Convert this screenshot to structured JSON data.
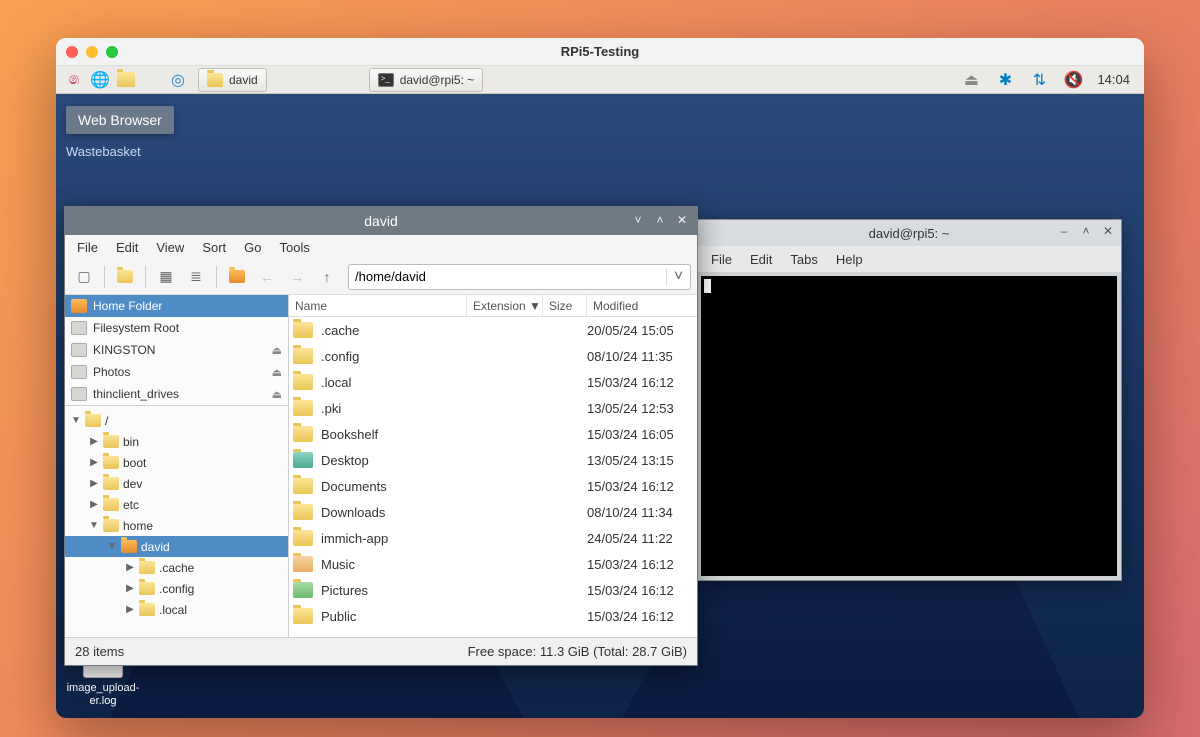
{
  "outer_title": "RPi5-Testing",
  "taskbar": {
    "tasks": [
      {
        "label": "david"
      },
      {
        "label": "david@rpi5: ~"
      }
    ],
    "clock": "14:04"
  },
  "tooltip": "Web Browser",
  "desktop": {
    "wastebasket": "Wastebasket",
    "icon_label": "image_upload-\ner.log"
  },
  "terminal": {
    "title": "david@rpi5: ~",
    "menu": [
      "File",
      "Edit",
      "Tabs",
      "Help"
    ]
  },
  "fm": {
    "title": "david",
    "menu": [
      "File",
      "Edit",
      "View",
      "Sort",
      "Go",
      "Tools"
    ],
    "path": "/home/david",
    "places": [
      {
        "label": "Home Folder",
        "icon": "home",
        "selected": true
      },
      {
        "label": "Filesystem Root",
        "icon": "drive"
      },
      {
        "label": "KINGSTON",
        "icon": "drive",
        "eject": true
      },
      {
        "label": "Photos",
        "icon": "drive",
        "eject": true
      },
      {
        "label": "thinclient_drives",
        "icon": "drive",
        "eject": true
      }
    ],
    "tree": [
      {
        "depth": 0,
        "arrow": "▼",
        "label": "/",
        "type": "fold"
      },
      {
        "depth": 1,
        "arrow": "▶",
        "label": "bin",
        "type": "fold"
      },
      {
        "depth": 1,
        "arrow": "▶",
        "label": "boot",
        "type": "fold"
      },
      {
        "depth": 1,
        "arrow": "▶",
        "label": "dev",
        "type": "fold"
      },
      {
        "depth": 1,
        "arrow": "▶",
        "label": "etc",
        "type": "fold"
      },
      {
        "depth": 1,
        "arrow": "▼",
        "label": "home",
        "type": "fold"
      },
      {
        "depth": 2,
        "arrow": "▼",
        "label": "david",
        "type": "home",
        "selected": true
      },
      {
        "depth": 3,
        "arrow": "▶",
        "label": ".cache",
        "type": "fold"
      },
      {
        "depth": 3,
        "arrow": "▶",
        "label": ".config",
        "type": "fold"
      },
      {
        "depth": 3,
        "arrow": "▶",
        "label": ".local",
        "type": "fold"
      }
    ],
    "columns": {
      "name": "Name",
      "ext": "Extension",
      "size": "Size",
      "mod": "Modified"
    },
    "files": [
      {
        "name": ".cache",
        "icon": "fold",
        "mod": "20/05/24 15:05"
      },
      {
        "name": ".config",
        "icon": "fold",
        "mod": "08/10/24 11:35"
      },
      {
        "name": ".local",
        "icon": "fold",
        "mod": "15/03/24 16:12"
      },
      {
        "name": ".pki",
        "icon": "fold",
        "mod": "13/05/24 12:53"
      },
      {
        "name": "Bookshelf",
        "icon": "fold",
        "mod": "15/03/24 16:05"
      },
      {
        "name": "Desktop",
        "icon": "desktop",
        "mod": "13/05/24 13:15"
      },
      {
        "name": "Documents",
        "icon": "fold",
        "mod": "15/03/24 16:12"
      },
      {
        "name": "Downloads",
        "icon": "fold",
        "mod": "08/10/24 11:34"
      },
      {
        "name": "immich-app",
        "icon": "fold",
        "mod": "24/05/24 11:22"
      },
      {
        "name": "Music",
        "icon": "music",
        "mod": "15/03/24 16:12"
      },
      {
        "name": "Pictures",
        "icon": "pics",
        "mod": "15/03/24 16:12"
      },
      {
        "name": "Public",
        "icon": "fold",
        "mod": "15/03/24 16:12"
      }
    ],
    "status_left": "28 items",
    "status_right": "Free space: 11.3 GiB (Total: 28.7 GiB)"
  }
}
